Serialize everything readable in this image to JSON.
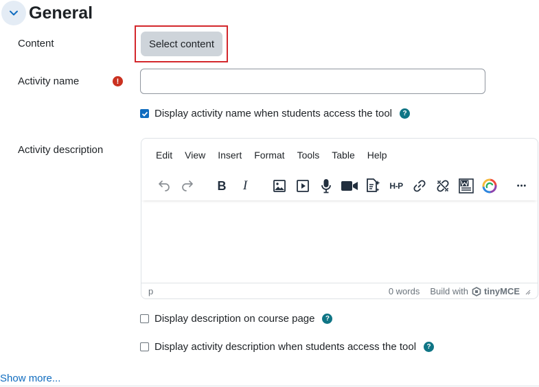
{
  "section": {
    "title": "General",
    "collapse_icon": "chevron-down-icon"
  },
  "content": {
    "label": "Content",
    "select_button": "Select content"
  },
  "activity_name": {
    "label": "Activity name",
    "value": "",
    "required_icon": "exclamation-icon",
    "required_glyph": "!"
  },
  "display_name_option": {
    "label": "Display activity name when students access the tool",
    "checked": true
  },
  "activity_description": {
    "label": "Activity description"
  },
  "editor": {
    "menu": [
      "Edit",
      "View",
      "Insert",
      "Format",
      "Tools",
      "Table",
      "Help"
    ],
    "toolbar_icons": [
      "undo-icon",
      "redo-icon",
      "bold-icon",
      "italic-icon",
      "image-icon",
      "media-icon",
      "microphone-icon",
      "video-icon",
      "manage-files-icon",
      "h5p-icon",
      "link-icon",
      "unlink-icon",
      "word-import-icon",
      "copilot-icon",
      "more-icon"
    ],
    "bold_glyph": "B",
    "italic_glyph": "I",
    "h5p_label": "H-P",
    "more_glyph": "•••",
    "status_path": "p",
    "word_count": "0 words",
    "brand_text": "Build with",
    "brand_name": "tinyMCE"
  },
  "display_description_option": {
    "label": "Display description on course page",
    "checked": false
  },
  "display_activity_description_option": {
    "label": "Display activity description when students access the tool",
    "checked": false
  },
  "help_glyph": "?",
  "show_more": "Show more...",
  "colors": {
    "accent": "#0f6cbf",
    "required": "#ca3120",
    "help": "#0f7585",
    "highlight": "#d3262b"
  }
}
